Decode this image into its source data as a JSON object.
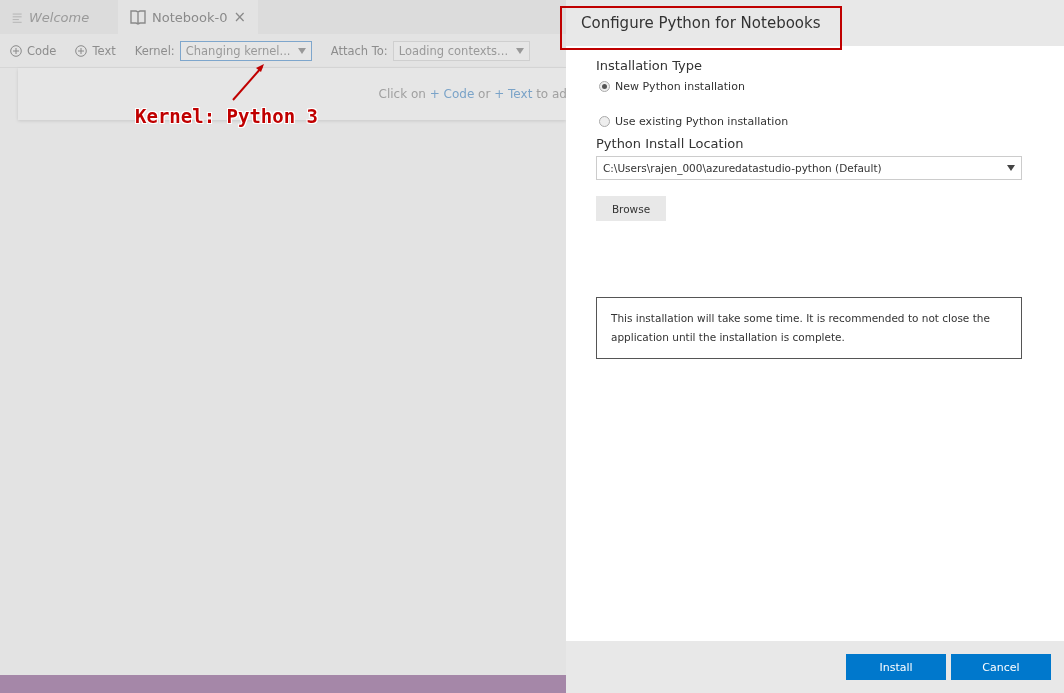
{
  "tabs": [
    {
      "label": "Welcome",
      "selected": false,
      "kind": "list"
    },
    {
      "label": "Notebook-0",
      "selected": true,
      "kind": "book",
      "close": "×"
    }
  ],
  "toolbar": {
    "add_buttons": [
      "Code",
      "Text"
    ],
    "kernel_label": "Kernel:",
    "kernel_value": "Changing kernel...",
    "attach_label": "Attach To:",
    "attach_value": "Loading contexts..."
  },
  "cell_hint": {
    "before": "Click on ",
    "code_link": "+ Code",
    "middle": " or ",
    "text_link": "+ Text",
    "after": " to ad"
  },
  "annotation": "Kernel: Python 3",
  "dialog": {
    "title": "Configure Python for Notebooks",
    "installation_type_label": "Installation Type",
    "options": [
      {
        "label": "New Python installation",
        "selected": true
      },
      {
        "label": "Use existing Python installation",
        "selected": false
      }
    ],
    "location_label": "Python Install Location",
    "location_value": "C:\\Users\\rajen_000\\azuredatastudio-python (Default)",
    "browse": "Browse",
    "notice": "This installation will take some time. It is recommended to not close the application until the installation is complete.",
    "buttons": [
      "Install",
      "Cancel"
    ]
  }
}
